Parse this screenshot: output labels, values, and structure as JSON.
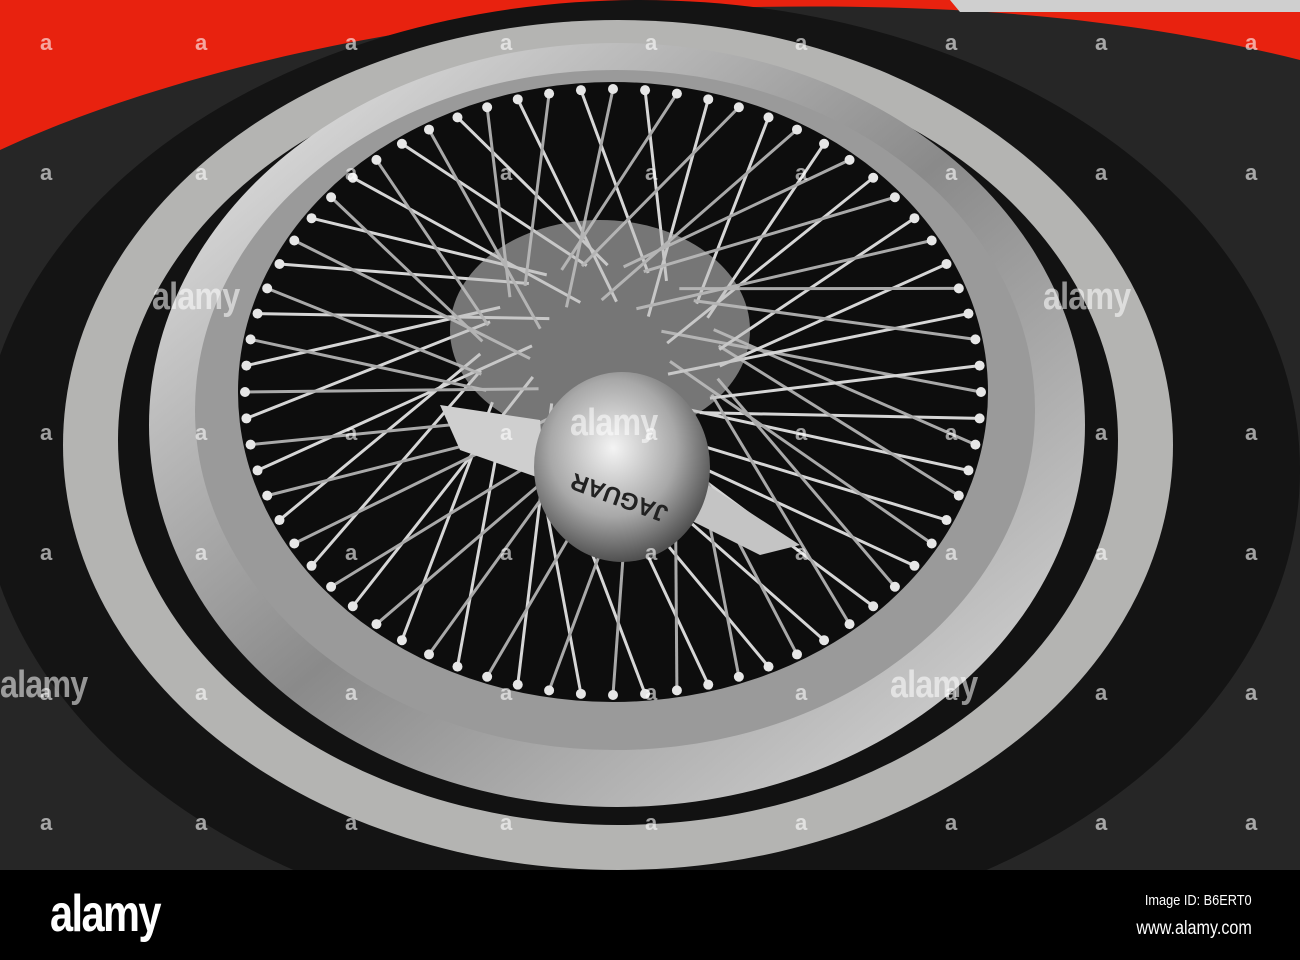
{
  "photo": {
    "hub_text": "JAGUAR",
    "colors": {
      "body": "#e8220f",
      "tire": "#141414",
      "whitewall": "#b4b4b2",
      "chrome": "#d8d8d8",
      "ground": "#2a2a2a"
    },
    "spoke_count": 72
  },
  "watermark": {
    "text": "alamy",
    "dot": "a"
  },
  "footer": {
    "logo": "alamy",
    "image_id": "Image ID: B6ERT0",
    "site": "www.alamy.com"
  }
}
